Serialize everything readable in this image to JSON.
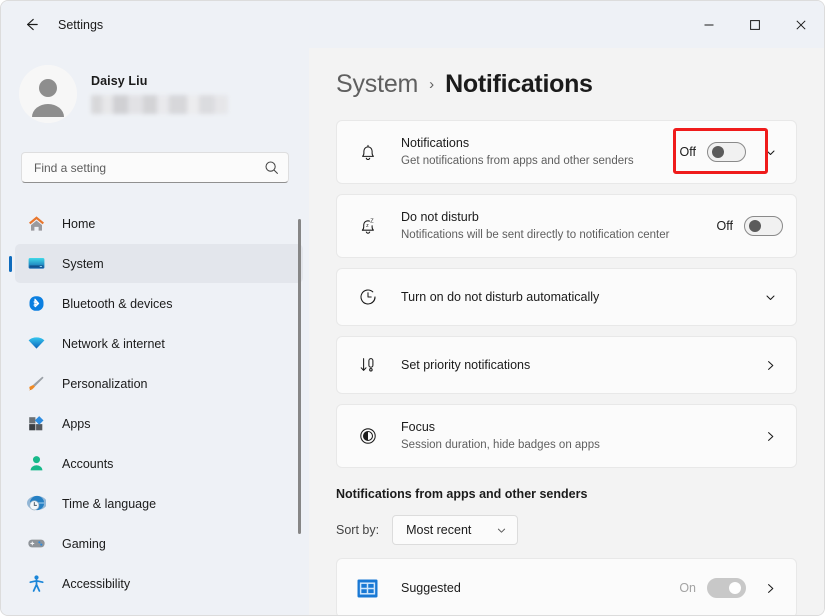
{
  "window": {
    "app_title": "Settings",
    "back_icon": "back-arrow-icon",
    "minimize_label": "—",
    "maximize_label": "□",
    "close_label": "✕"
  },
  "sidebar": {
    "profile": {
      "name": "Daisy Liu",
      "email_redacted": ""
    },
    "search": {
      "placeholder": "Find a setting",
      "value": "",
      "icon": "search-icon"
    },
    "items": [
      {
        "label": "Home",
        "icon": "home-icon",
        "active": false
      },
      {
        "label": "System",
        "icon": "system-monitor-icon",
        "active": true
      },
      {
        "label": "Bluetooth & devices",
        "icon": "bluetooth-icon",
        "active": false
      },
      {
        "label": "Network & internet",
        "icon": "wifi-icon",
        "active": false
      },
      {
        "label": "Personalization",
        "icon": "paintbrush-icon",
        "active": false
      },
      {
        "label": "Apps",
        "icon": "apps-icon",
        "active": false
      },
      {
        "label": "Accounts",
        "icon": "account-person-icon",
        "active": false
      },
      {
        "label": "Time & language",
        "icon": "globe-clock-icon",
        "active": false
      },
      {
        "label": "Gaming",
        "icon": "gamepad-icon",
        "active": false
      },
      {
        "label": "Accessibility",
        "icon": "accessibility-person-icon",
        "active": false
      }
    ]
  },
  "content": {
    "breadcrumb": {
      "parent": "System",
      "separator": "›",
      "current": "Notifications"
    },
    "cards": [
      {
        "title": "Notifications",
        "subtitle": "Get notifications from apps and other senders",
        "icon": "bell-icon",
        "toggle_label": "Off",
        "toggle_state": "off",
        "trailing": "chevron-down-icon",
        "highlighted": true
      },
      {
        "title": "Do not disturb",
        "subtitle": "Notifications will be sent directly to notification center",
        "icon": "bell-sleep-icon",
        "toggle_label": "Off",
        "toggle_state": "off",
        "trailing": "none",
        "highlighted": false
      },
      {
        "title": "Turn on do not disturb automatically",
        "subtitle": "",
        "icon": "clock-icon",
        "toggle_label": "",
        "toggle_state": "none",
        "trailing": "chevron-down-icon",
        "highlighted": false
      },
      {
        "title": "Set priority notifications",
        "subtitle": "",
        "icon": "priority-sort-icon",
        "toggle_label": "",
        "toggle_state": "none",
        "trailing": "chevron-right-icon",
        "highlighted": false
      },
      {
        "title": "Focus",
        "subtitle": "Session duration, hide badges on apps",
        "icon": "focus-icon",
        "toggle_label": "",
        "toggle_state": "none",
        "trailing": "chevron-right-icon",
        "highlighted": false
      }
    ],
    "apps_section": {
      "heading": "Notifications from apps and other senders",
      "sort_label": "Sort by:",
      "sort_value": "Most recent",
      "sort_chevron": "chevron-down-icon",
      "apps": [
        {
          "name": "Suggested",
          "icon": "suggested-app-icon",
          "toggle_label": "On",
          "toggle_state": "on-disabled",
          "trailing": "chevron-right-icon"
        }
      ]
    }
  },
  "colors": {
    "accent": "#0f6cbd",
    "annotation": "#ef1b1b",
    "sidebar_bg": "#eef1f6",
    "content_bg": "#f3f3f3",
    "card_bg": "#fbfbfb"
  }
}
